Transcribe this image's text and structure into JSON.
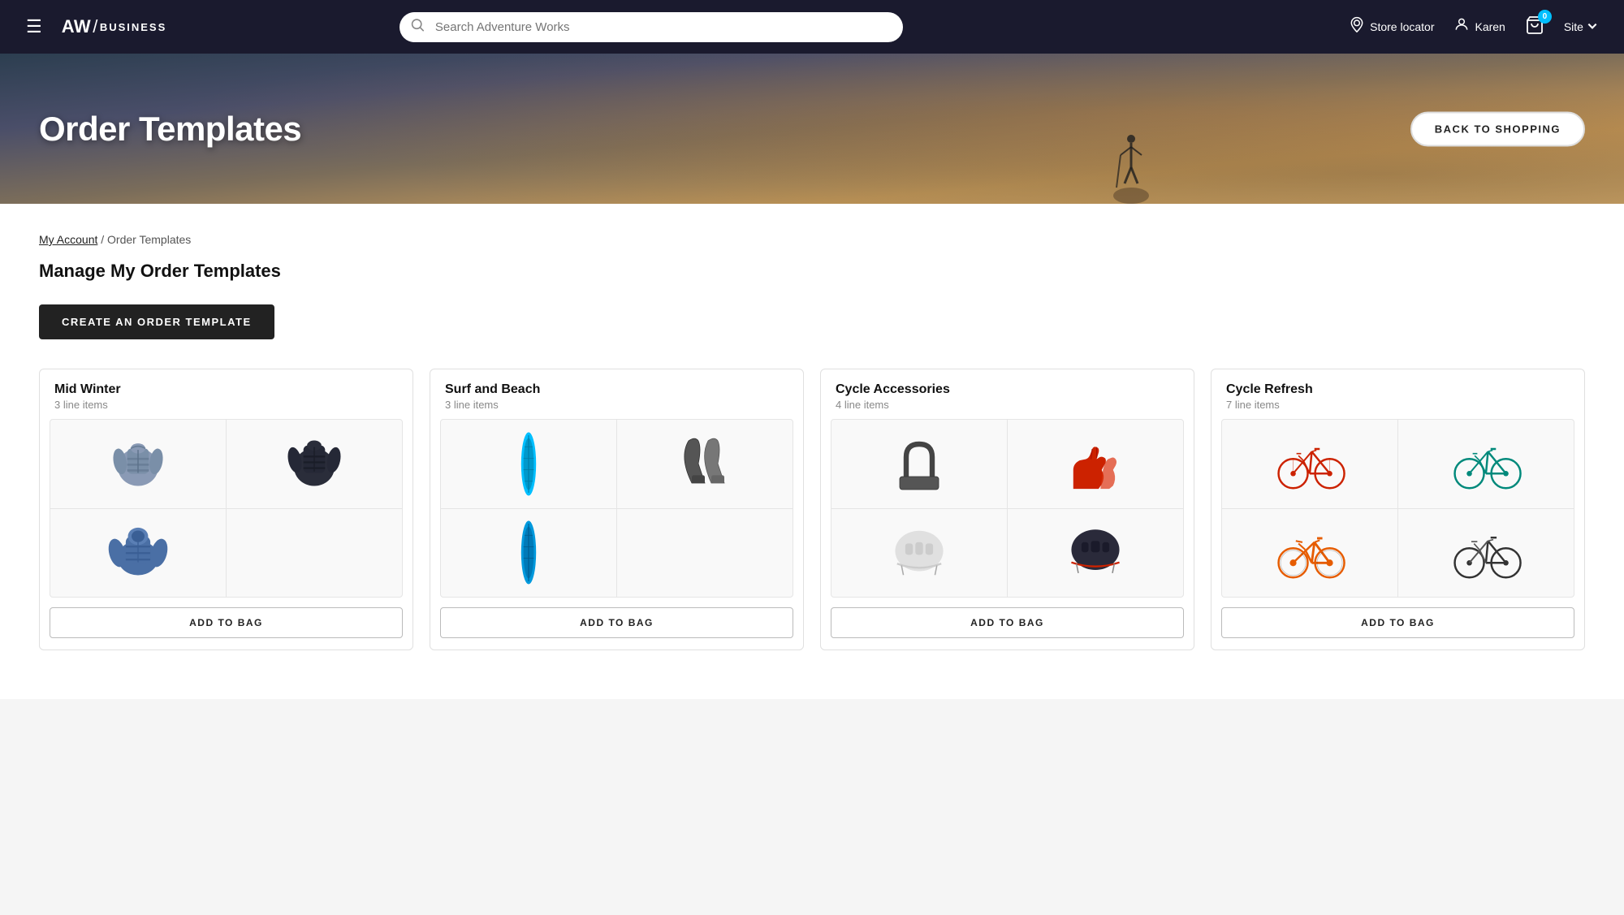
{
  "header": {
    "logo_aw": "AW",
    "logo_slash": "/",
    "logo_business": "BUSINESS",
    "search_placeholder": "Search Adventure Works",
    "store_locator_label": "Store locator",
    "user_name": "Karen",
    "cart_badge": "0",
    "site_label": "Site",
    "hamburger_icon": "☰"
  },
  "hero": {
    "title": "Order Templates",
    "back_button_label": "BACK TO SHOPPING"
  },
  "breadcrumb": {
    "my_account_label": "My Account",
    "separator": "/",
    "current": "Order Templates"
  },
  "main": {
    "section_title": "Manage My Order Templates",
    "create_button_label": "CREATE AN ORDER TEMPLATE"
  },
  "templates": [
    {
      "id": "mid-winter",
      "title": "Mid Winter",
      "subtitle": "3 line items",
      "add_label": "ADD TO BAG"
    },
    {
      "id": "surf-and-beach",
      "title": "Surf and Beach",
      "subtitle": "3 line items",
      "add_label": "ADD TO BAG"
    },
    {
      "id": "cycle-accessories",
      "title": "Cycle Accessories",
      "subtitle": "4 line items",
      "add_label": "ADD TO BAG"
    },
    {
      "id": "cycle-refresh",
      "title": "Cycle Refresh",
      "subtitle": "7 line items",
      "add_label": "ADD TO BAG"
    }
  ]
}
